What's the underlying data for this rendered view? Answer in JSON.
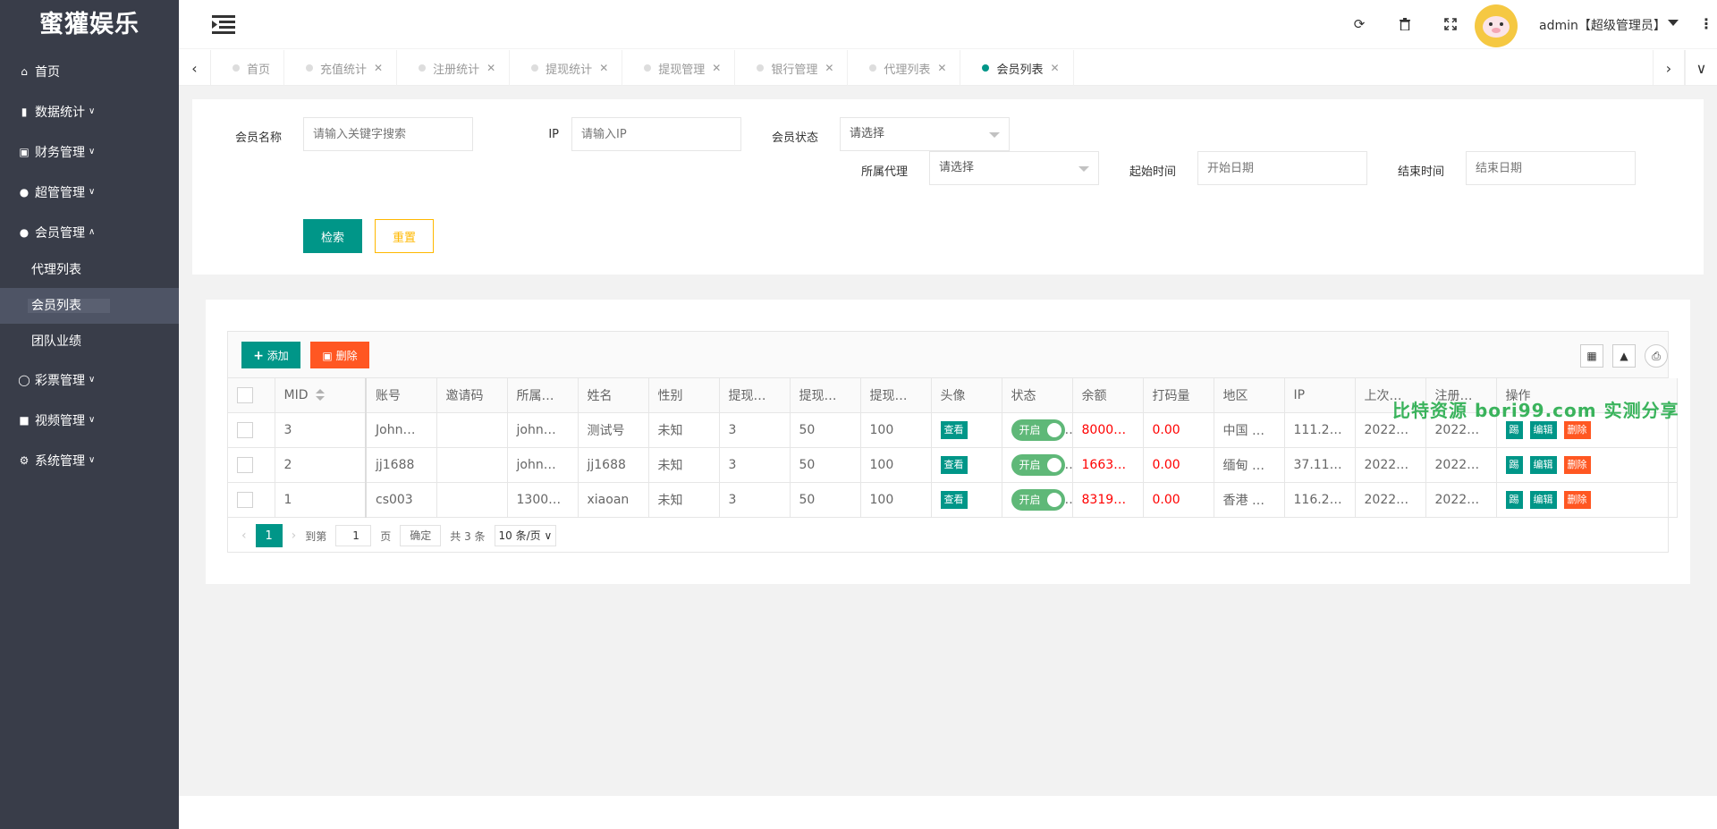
{
  "sidebar": {
    "logo": "蜜獾娱乐",
    "items": [
      {
        "label": "首页"
      },
      {
        "label": "数据统计"
      },
      {
        "label": "财务管理"
      },
      {
        "label": "超管管理"
      },
      {
        "label": "会员管理"
      },
      {
        "label": "彩票管理"
      },
      {
        "label": "视频管理"
      },
      {
        "label": "系统管理"
      }
    ],
    "sub_items": [
      {
        "label": "代理列表"
      },
      {
        "label": "会员列表"
      },
      {
        "label": "团队业绩"
      }
    ]
  },
  "header": {
    "user": "admin【超级管理员】"
  },
  "tabs": [
    {
      "label": "首页"
    },
    {
      "label": "充值统计"
    },
    {
      "label": "注册统计"
    },
    {
      "label": "提现统计"
    },
    {
      "label": "提现管理"
    },
    {
      "label": "银行管理"
    },
    {
      "label": "代理列表"
    },
    {
      "label": "会员列表"
    }
  ],
  "search": {
    "member_name_label": "会员名称",
    "member_name_placeholder": "请输入关键字搜索",
    "ip_label": "IP",
    "ip_placeholder": "请输入IP",
    "status_label": "会员状态",
    "status_value": "请选择",
    "agent_label": "所属代理",
    "agent_value": "请选择",
    "start_label": "起始时间",
    "start_placeholder": "开始日期",
    "end_label": "结束时间",
    "end_placeholder": "结束日期",
    "search_btn": "检索",
    "reset_btn": "重置"
  },
  "toolbar": {
    "add_btn": "添加",
    "delete_btn": "删除"
  },
  "table": {
    "columns": [
      "MID",
      "账号",
      "邀请码",
      "所属…",
      "姓名",
      "性别",
      "提现…",
      "提现…",
      "提现…",
      "头像",
      "状态",
      "余额",
      "打码量",
      "地区",
      "IP",
      "上次…",
      "注册…",
      "操作"
    ],
    "rows": [
      {
        "mid": "3",
        "account": "John…",
        "invite": "",
        "agent": "john…",
        "name": "测试号",
        "gender": "未知",
        "w1": "3",
        "w2": "50",
        "w3": "100",
        "avatar_btn": "查看",
        "status": "开启",
        "balance": "8000…",
        "bet": "0.00",
        "region": "中国 …",
        "ip": "111.2…",
        "last": "2022…",
        "reg": "2022…"
      },
      {
        "mid": "2",
        "account": "jj1688",
        "invite": "",
        "agent": "john…",
        "name": "jj1688",
        "gender": "未知",
        "w1": "3",
        "w2": "50",
        "w3": "100",
        "avatar_btn": "查看",
        "status": "开启",
        "balance": "1663…",
        "bet": "0.00",
        "region": "缅甸 …",
        "ip": "37.11…",
        "last": "2022…",
        "reg": "2022…"
      },
      {
        "mid": "1",
        "account": "cs003",
        "invite": "",
        "agent": "1300…",
        "name": "xiaoan",
        "gender": "未知",
        "w1": "3",
        "w2": "50",
        "w3": "100",
        "avatar_btn": "查看",
        "status": "开启",
        "balance": "8319…",
        "bet": "0.00",
        "region": "香港 …",
        "ip": "116.2…",
        "last": "2022…",
        "reg": "2022…"
      }
    ],
    "action_labels": {
      "key": "踢",
      "edit": "编辑",
      "delete": "删除"
    }
  },
  "pager": {
    "current": "1",
    "goto_label": "到第",
    "goto_value": "1",
    "page_label": "页",
    "confirm": "确定",
    "total": "共 3 条",
    "page_size": "10 条/页"
  },
  "watermark": "比特资源 bori99.com 实测分享",
  "colors": {
    "primary": "#009688",
    "danger": "#ff5722",
    "warn": "#ffb800",
    "sidebar": "#393d49"
  }
}
